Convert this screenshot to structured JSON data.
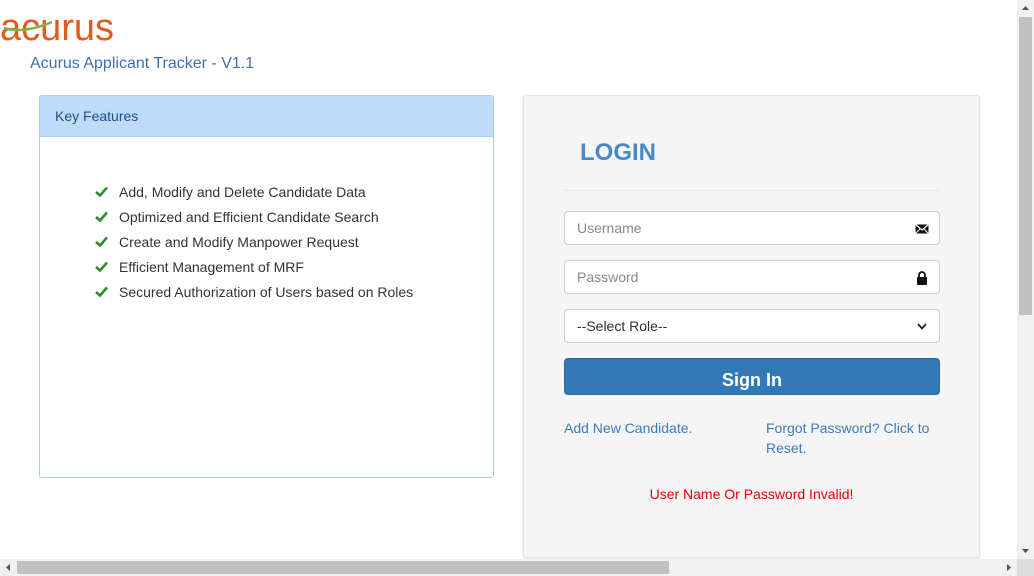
{
  "logo": {
    "text": "acurus",
    "color": "#e25a1c",
    "swoosh_color": "#7cb342"
  },
  "app_title": "Acurus Applicant Tracker - V1.1",
  "features": {
    "header": "Key Features",
    "items": [
      "Add, Modify and Delete Candidate Data",
      "Optimized and Efficient Candidate Search",
      "Create and Modify Manpower Request",
      "Efficient Management of MRF",
      "Secured Authorization of Users based on Roles"
    ],
    "icon": "check-icon",
    "icon_color": "#2e8b2e"
  },
  "login": {
    "title": "LOGIN",
    "username": {
      "value": "",
      "placeholder": "Username",
      "icon": "envelope-icon"
    },
    "password": {
      "value": "",
      "placeholder": "Password",
      "icon": "lock-icon"
    },
    "role": {
      "selected": "--Select Role--",
      "icon": "chevron-down-icon"
    },
    "signin_label": "Sign In",
    "add_candidate_link": "Add New Candidate.",
    "forgot_password_link": "Forgot Password? Click to Reset.",
    "error_message": "User Name Or Password Invalid!"
  },
  "colors": {
    "accent": "#3378b7",
    "title_blue": "#4a88c6",
    "panel_header": "#bedbf9",
    "error": "#e8000b"
  }
}
